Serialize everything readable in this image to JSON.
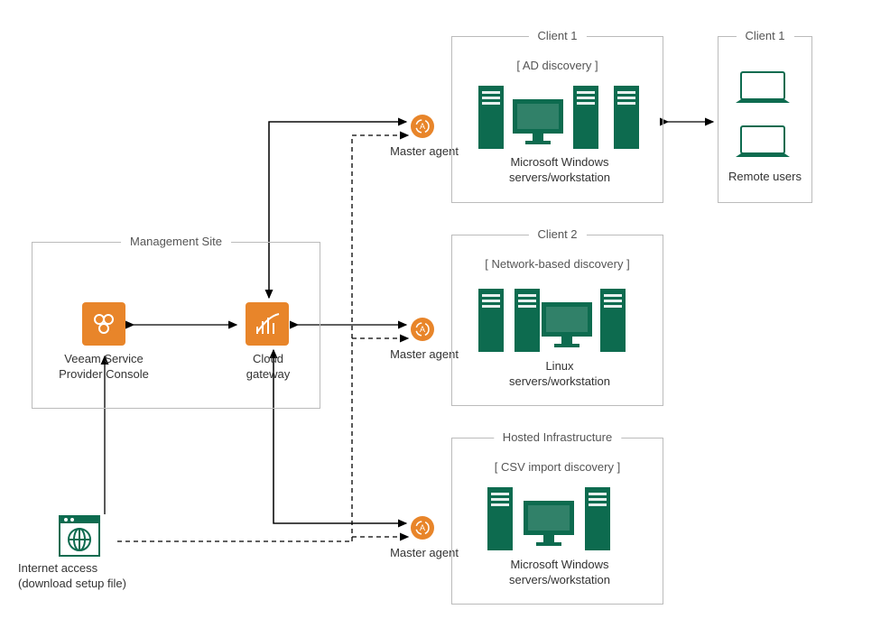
{
  "management": {
    "title": "Management Site",
    "vspc": "Veeam Service\nProvider Console",
    "gateway": "Cloud\ngateway"
  },
  "internet": {
    "label": "Internet  access\n(download setup file)"
  },
  "agents": {
    "a1": "Master agent",
    "a2": "Master agent",
    "a3": "Master agent"
  },
  "client1": {
    "title": "Client 1",
    "discovery": "[ AD discovery ]",
    "label": "Microsoft Windows\nservers/workstation"
  },
  "client2": {
    "title": "Client 2",
    "discovery": "[ Network-based discovery ]",
    "label": "Linux\nservers/workstation"
  },
  "hosted": {
    "title": "Hosted Infrastructure",
    "discovery": "[ CSV import discovery ]",
    "label": "Microsoft Windows\nservers/workstation"
  },
  "remote": {
    "title": "Client 1",
    "label": "Remote users"
  },
  "colors": {
    "orange": "#e8852a",
    "green": "#0d6b4f",
    "border": "#bbbbbb"
  }
}
